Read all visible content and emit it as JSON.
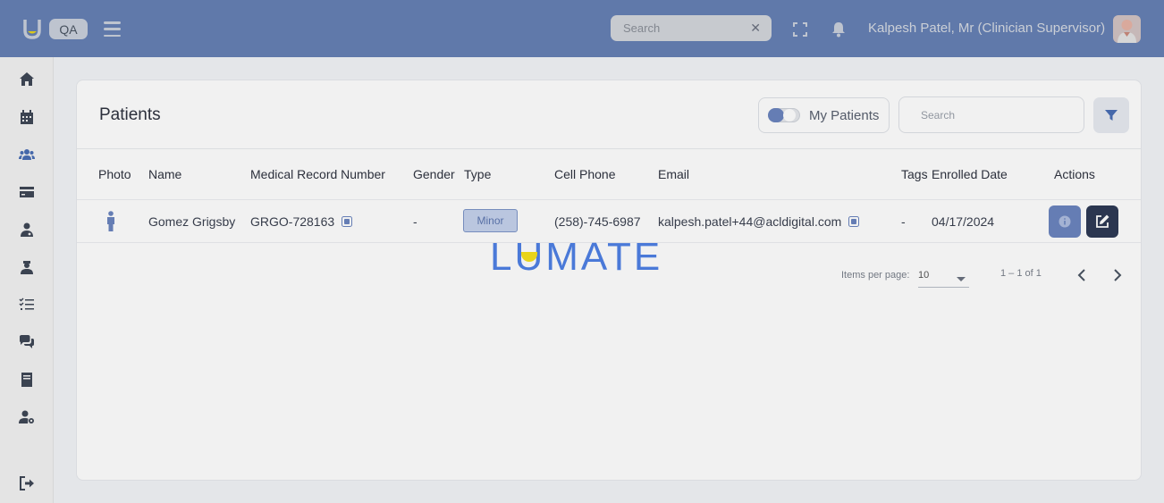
{
  "header": {
    "env_badge": "QA",
    "search_placeholder": "Search",
    "clear_icon": "close-icon",
    "user_name": "Kalpesh Patel, Mr (Clinician Supervisor)",
    "accent_color": "#6680b4"
  },
  "sidebar": {
    "items": [
      {
        "name": "home",
        "icon": "home-icon"
      },
      {
        "name": "calendar",
        "icon": "calendar-icon"
      },
      {
        "name": "patients",
        "icon": "users-icon"
      },
      {
        "name": "billing",
        "icon": "credit-card-icon"
      },
      {
        "name": "clinicians",
        "icon": "user-md-icon"
      },
      {
        "name": "staff",
        "icon": "user-nurse-icon"
      },
      {
        "name": "tasks",
        "icon": "checklist-icon"
      },
      {
        "name": "messages",
        "icon": "comments-icon"
      },
      {
        "name": "documents",
        "icon": "book-icon"
      },
      {
        "name": "user-settings",
        "icon": "user-gear-icon"
      },
      {
        "name": "logout",
        "icon": "sign-out-icon"
      }
    ]
  },
  "main": {
    "title": "Patients",
    "my_patients_label": "My Patients",
    "search_placeholder": "Search",
    "columns": [
      "Photo",
      "Name",
      "Medical Record Number",
      "Gender",
      "Type",
      "Cell Phone",
      "Email",
      "Tags",
      "Enrolled Date",
      "Actions"
    ],
    "rows": [
      {
        "name": "Gomez Grigsby",
        "mrn": "GRGO-728163",
        "gender": "-",
        "type": "Minor",
        "cell_phone": "(258)-745-6987",
        "email": "kalpesh.patel+44@acldigital.com",
        "tags": "-",
        "enrolled_date": "04/17/2024"
      }
    ],
    "pagination": {
      "items_per_page_label": "Items per page:",
      "items_per_page": "10",
      "range": "1 – 1 of 1"
    }
  },
  "loading_logo": {
    "text": "LUMATE",
    "color": "#4a79d8"
  }
}
